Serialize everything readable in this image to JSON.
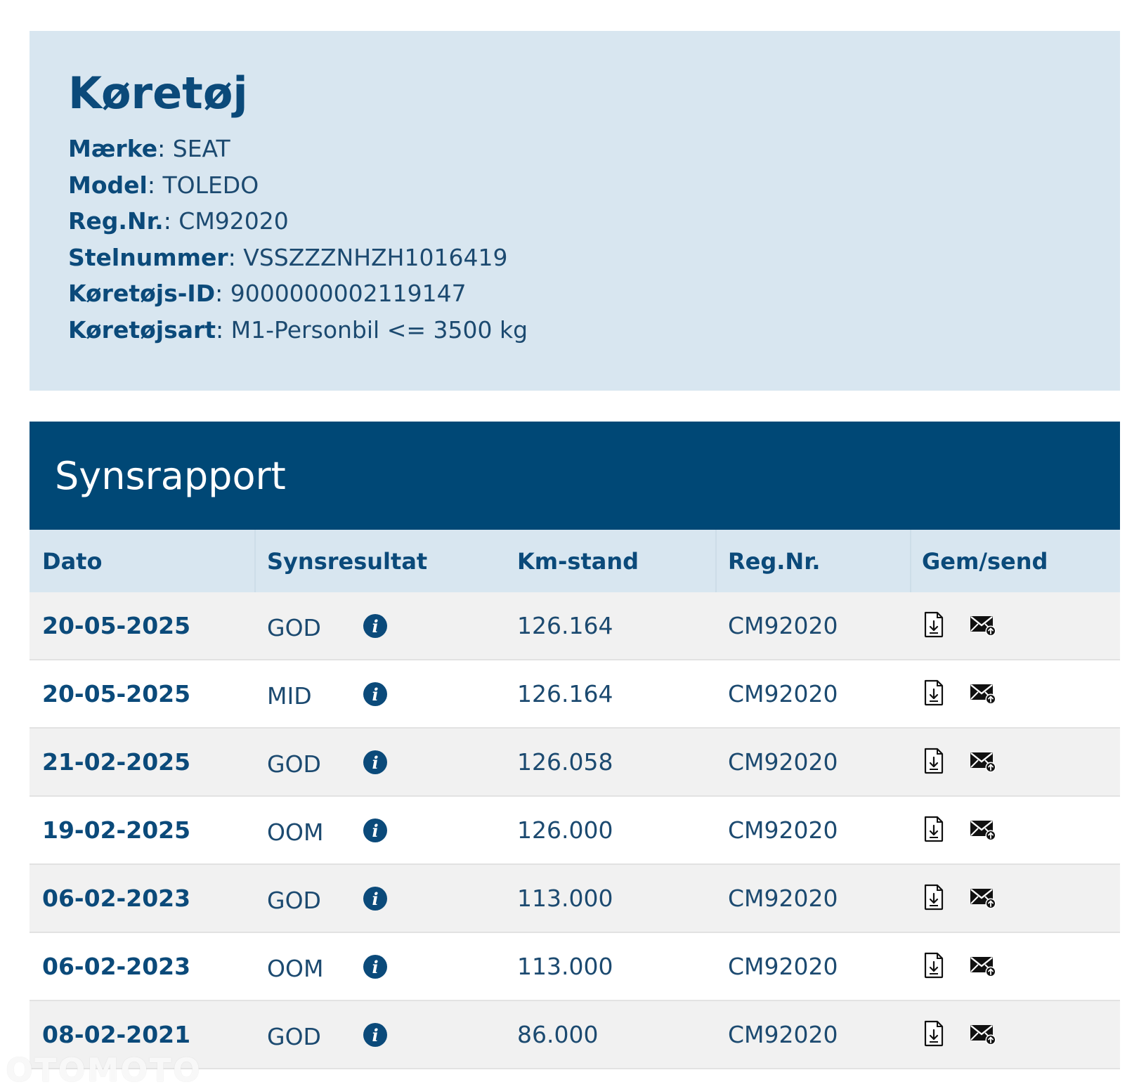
{
  "vehicle": {
    "title": "Køretøj",
    "fields": [
      {
        "label": "Mærke",
        "value": "SEAT"
      },
      {
        "label": "Model",
        "value": "TOLEDO"
      },
      {
        "label": "Reg.Nr.",
        "value": "CM92020"
      },
      {
        "label": "Stelnummer",
        "value": "VSSZZZNHZH1016419"
      },
      {
        "label": "Køretøjs-ID",
        "value": "9000000002119147"
      },
      {
        "label": "Køretøjsart",
        "value": "M1-Personbil <= 3500 kg"
      }
    ]
  },
  "report": {
    "title": "Synsrapport",
    "columns": [
      "Dato",
      "Synsresultat",
      "Km-stand",
      "Reg.Nr.",
      "Gem/send"
    ],
    "rows": [
      {
        "date": "20-05-2025",
        "result": "GOD",
        "km": "126.164",
        "reg": "CM92020"
      },
      {
        "date": "20-05-2025",
        "result": "MID",
        "km": "126.164",
        "reg": "CM92020"
      },
      {
        "date": "21-02-2025",
        "result": "GOD",
        "km": "126.058",
        "reg": "CM92020"
      },
      {
        "date": "19-02-2025",
        "result": "OOM",
        "km": "126.000",
        "reg": "CM92020"
      },
      {
        "date": "06-02-2023",
        "result": "GOD",
        "km": "113.000",
        "reg": "CM92020"
      },
      {
        "date": "06-02-2023",
        "result": "OOM",
        "km": "113.000",
        "reg": "CM92020"
      },
      {
        "date": "08-02-2021",
        "result": "GOD",
        "km": "86.000",
        "reg": "CM92020"
      }
    ],
    "icons": {
      "info": "info-icon",
      "download": "document-download-icon",
      "send": "mail-send-icon"
    }
  },
  "watermark": "OTOMOTO",
  "colors": {
    "header_bg": "#004876",
    "panel_bg": "#d8e6f0",
    "text_primary": "#0b4a7a"
  }
}
